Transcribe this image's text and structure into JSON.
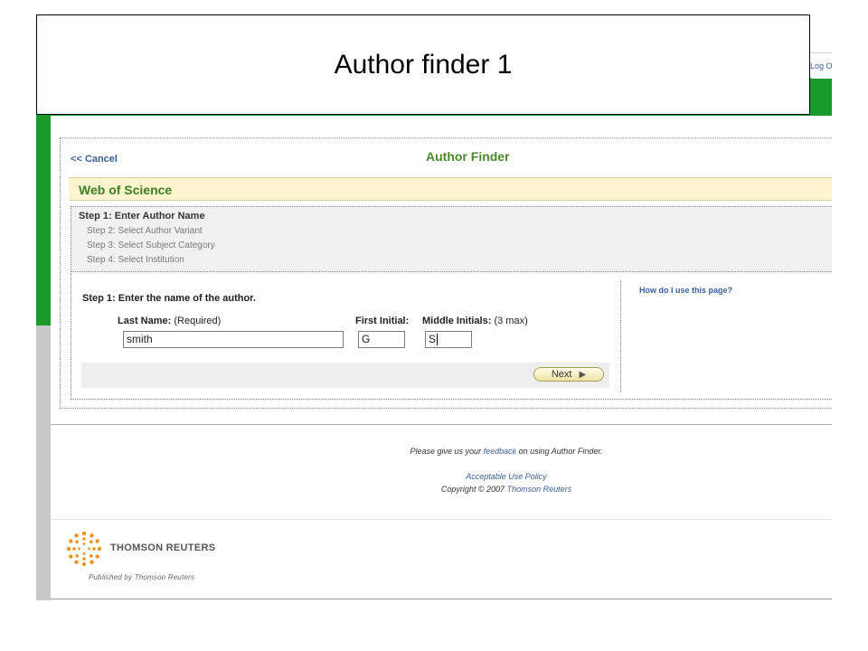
{
  "slide": {
    "title": "Author finder 1"
  },
  "header": {
    "logout_label": "Log O"
  },
  "finder": {
    "cancel_label": "<< Cancel",
    "title": "Author Finder",
    "database": "Web of Science"
  },
  "steps": [
    {
      "prefix": "Step 1:",
      "label": "Enter Author Name"
    },
    {
      "label": "Step 2: Select Author Variant"
    },
    {
      "label": "Step 3: Select Subject Category"
    },
    {
      "label": "Step 4: Select Institution"
    }
  ],
  "form": {
    "heading": "Step 1: Enter the name of the author.",
    "last_name": {
      "label": "Last Name:",
      "note": "(Required)",
      "value": "smith"
    },
    "first_initial": {
      "label": "First Initial:",
      "value": "G"
    },
    "middle_initials": {
      "label": "Middle Initials:",
      "note": "(3 max)",
      "value": "S"
    },
    "next_label": "Next",
    "help_link": "How do I use this page?"
  },
  "footer": {
    "feedback_pre": "Please give us your",
    "feedback_link": "feedback",
    "feedback_post": "on using Author Finder.",
    "policy_link": "Acceptable Use Policy",
    "copyright": "Copyright © 2007",
    "copyright_link": "Thomson Reuters",
    "brand": "THOMSON REUTERS",
    "published": "Published by Thomson Reuters"
  },
  "colors": {
    "green": "#1a9a2a",
    "link_blue": "#3a5fa0",
    "title_green": "#4a8a2a",
    "banner_yellow": "#fbf4cf"
  }
}
